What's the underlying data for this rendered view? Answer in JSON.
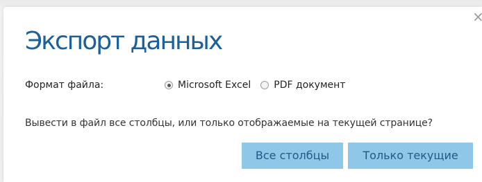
{
  "dialog": {
    "title": "Экспорт данных",
    "close_label": "×"
  },
  "format": {
    "label": "Формат файла:",
    "options": [
      {
        "label": "Microsoft Excel",
        "selected": true
      },
      {
        "label": "PDF документ",
        "selected": false
      }
    ]
  },
  "question": "Вывести в файл все столбцы, или только отображаемые на текущей странице?",
  "buttons": {
    "all_label": "Все столбцы",
    "current_label": "Только текущие"
  },
  "colors": {
    "title": "#1b5f9b",
    "button_bg": "#8fc7e8",
    "button_text": "#1e5a85"
  }
}
